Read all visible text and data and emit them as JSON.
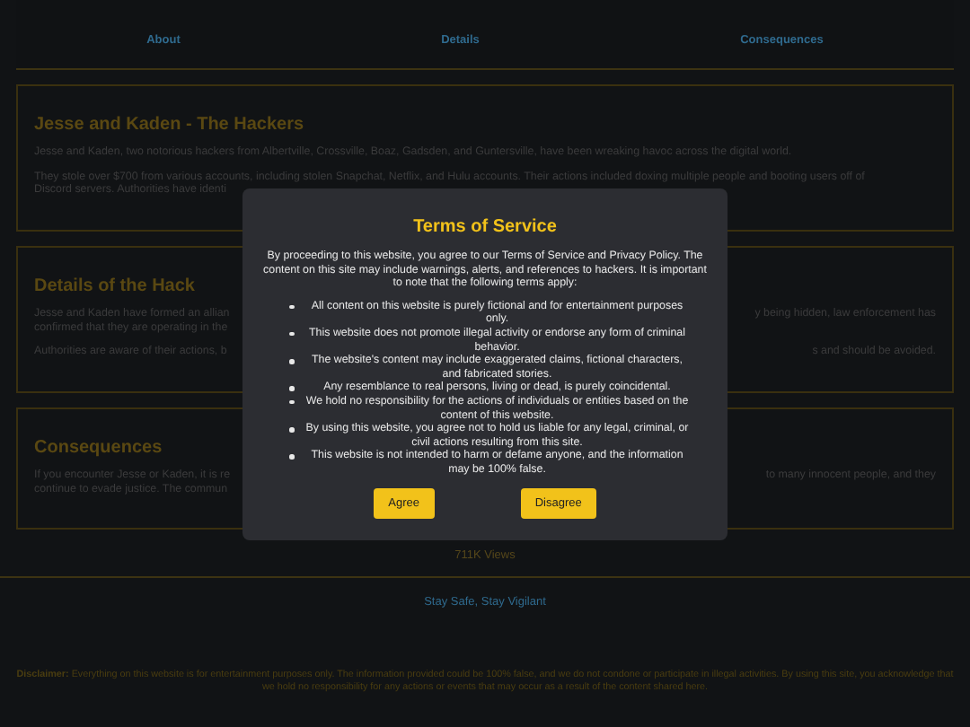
{
  "nav": {
    "links": [
      {
        "label": "About"
      },
      {
        "label": "Details"
      },
      {
        "label": "Consequences"
      }
    ]
  },
  "sections": [
    {
      "title": "Jesse and Kaden - The Hackers",
      "paragraphs": [
        {
          "lines": [
            {
              "left": "Jesse and Kaden, two notorious hackers from Albertville, Crossville, Boaz, Gadsden, and Guntersville, have been wreaking havoc across the digital world."
            }
          ]
        },
        {
          "lines": [
            {
              "left": "They stole over $700 from various accounts, including stolen Snapchat, Netflix, and Hulu accounts. Their actions included doxing multiple people and booting users off of"
            },
            {
              "left": "Discord servers. Authorities have identi"
            }
          ]
        }
      ]
    },
    {
      "title": "Details of the Hack",
      "paragraphs": [
        {
          "lines": [
            {
              "left": "Jesse and Kaden have formed an allian",
              "right": "y being hidden, law enforcement has"
            },
            {
              "left": "confirmed that they are operating in the"
            }
          ]
        },
        {
          "lines": [
            {
              "left": "Authorities are aware of their actions, b",
              "right": "s and should be avoided."
            }
          ]
        }
      ]
    },
    {
      "title": "Consequences",
      "paragraphs": [
        {
          "lines": [
            {
              "left": "If you encounter Jesse or Kaden, it is re",
              "right": "to many innocent people, and they"
            },
            {
              "left": "continue to evade justice. The commun"
            }
          ]
        }
      ]
    }
  ],
  "views": "711K Views",
  "tagline": "Stay Safe, Stay Vigilant",
  "disclaimer": {
    "label": "Disclaimer:",
    "text": "Everything on this website is for entertainment purposes only. The information provided could be 100% false, and we do not condone or participate in illegal activities. By using this site, you acknowledge that we hold no responsibility for any actions or events that may occur as a result of the content shared here."
  },
  "modal": {
    "title": "Terms of Service",
    "intro": "By proceeding to this website, you agree to our Terms of Service and Privacy Policy. The content on this site may include warnings, alerts, and references to hackers. It is important to note that the following terms apply:",
    "terms": [
      "All content on this website is purely fictional and for entertainment purposes only.",
      "This website does not promote illegal activity or endorse any form of criminal behavior.",
      "The website's content may include exaggerated claims, fictional characters, and fabricated stories.",
      "Any resemblance to real persons, living or dead, is purely coincidental.",
      "We hold no responsibility for the actions of individuals or entities based on the content of this website.",
      "By using this website, you agree not to hold us liable for any legal, criminal, or civil actions resulting from this site.",
      "This website is not intended to harm or defame anyone, and the information may be 100% false."
    ],
    "buttons": [
      "Agree",
      "Disagree"
    ]
  }
}
